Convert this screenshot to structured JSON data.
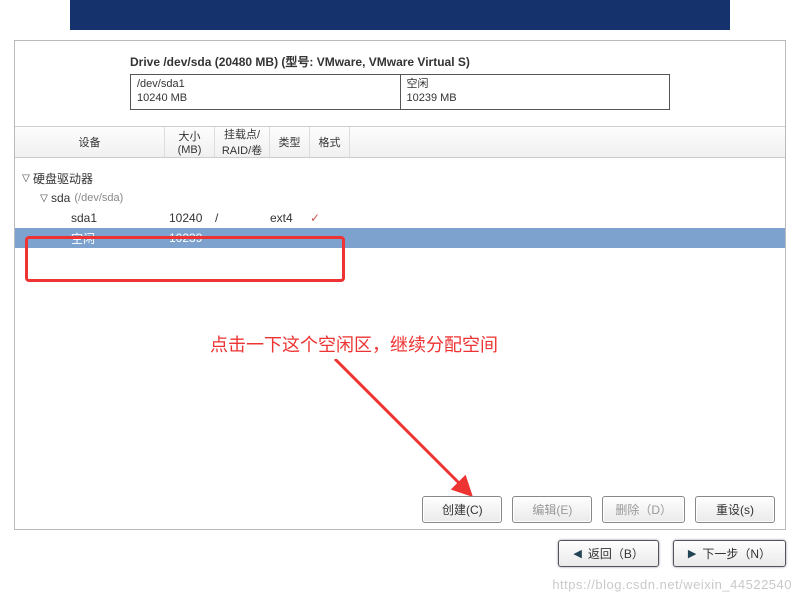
{
  "drive": {
    "title": "Drive /dev/sda (20480 MB) (型号: VMware, VMware Virtual S)",
    "parts": [
      {
        "name": "/dev/sda1",
        "size": "10240 MB"
      },
      {
        "name": "空闲",
        "size": "10239 MB"
      }
    ]
  },
  "columns": {
    "device": "设备",
    "size": "大小\n(MB)",
    "mount": "挂载点/ RAID/卷",
    "type": "类型",
    "format": "格式"
  },
  "tree": {
    "root": "硬盘驱动器",
    "disk": {
      "name": "sda",
      "path": "(/dev/sda)"
    },
    "rows": [
      {
        "name": "sda1",
        "size": "10240",
        "mount": "/",
        "type": "ext4",
        "fmt": true,
        "selected": false
      },
      {
        "name": "空闲",
        "size": "10239",
        "mount": "",
        "type": "",
        "fmt": false,
        "selected": true
      }
    ]
  },
  "annotation": "点击一下这个空闲区，继续分配空间",
  "buttons": {
    "create": "创建(C)",
    "edit": "编辑(E)",
    "delete": "删除（D）",
    "reset": "重设(s)"
  },
  "nav": {
    "back": "返回（B）",
    "next": "下一步（N）"
  },
  "watermark": "https://blog.csdn.net/weixin_44522540"
}
